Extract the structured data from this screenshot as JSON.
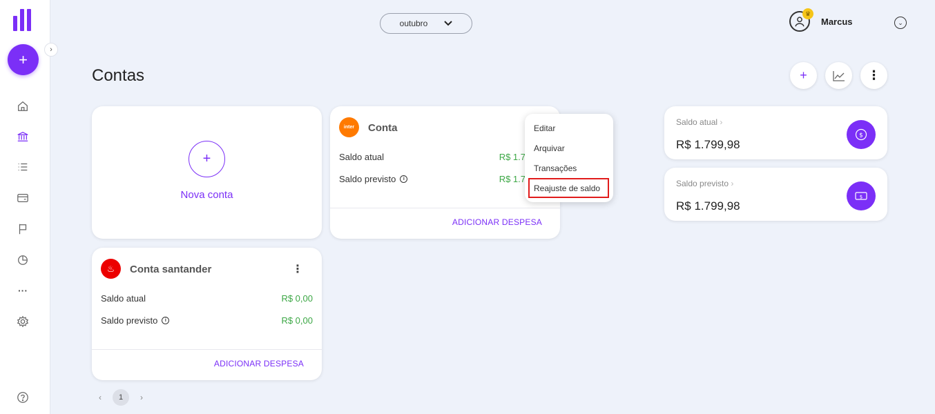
{
  "header": {
    "month": "outubro",
    "user_name": "Marcus"
  },
  "page": {
    "title": "Contas"
  },
  "new_account": {
    "label": "Nova conta"
  },
  "accounts": [
    {
      "name": "Conta",
      "logo_text": "inter",
      "logo_color": "#ff7a00",
      "saldo_atual_label": "Saldo atual",
      "saldo_atual_value": "R$ 1.7",
      "saldo_previsto_label": "Saldo previsto",
      "saldo_previsto_value": "R$ 1.7",
      "add_expense": "ADICIONAR DESPESA"
    },
    {
      "name": "Conta santander",
      "logo_color": "#ec0000",
      "saldo_atual_label": "Saldo atual",
      "saldo_atual_value": "R$ 0,00",
      "saldo_previsto_label": "Saldo previsto",
      "saldo_previsto_value": "R$ 0,00",
      "add_expense": "ADICIONAR DESPESA"
    }
  ],
  "context_menu": {
    "items": [
      "Editar",
      "Arquivar",
      "Transações",
      "Reajuste de saldo"
    ]
  },
  "summary": [
    {
      "label": "Saldo atual",
      "value": "R$ 1.799,98"
    },
    {
      "label": "Saldo previsto",
      "value": "R$ 1.799,98"
    }
  ],
  "pagination": {
    "current_page": "1"
  },
  "colors": {
    "accent": "#7b2ff7",
    "positive": "#3ca745",
    "highlight": "#e11b1b",
    "background": "#eef2fa"
  }
}
